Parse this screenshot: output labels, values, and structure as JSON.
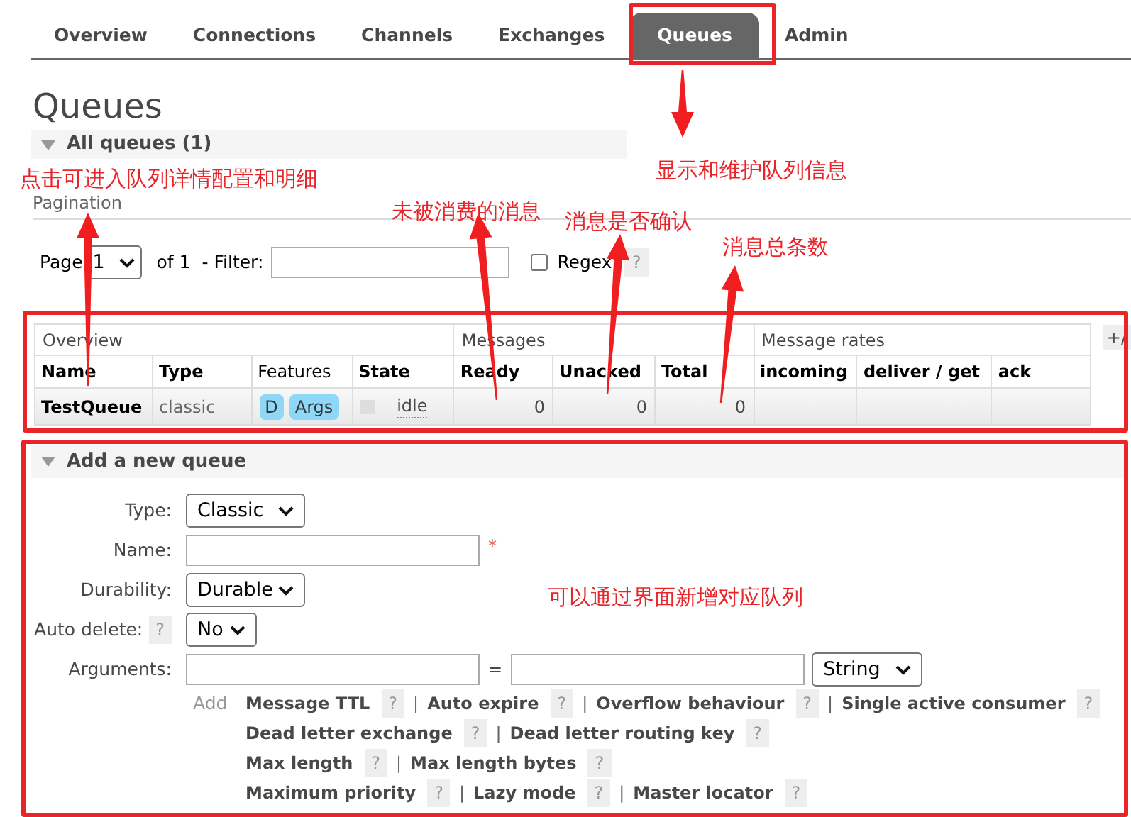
{
  "nav": {
    "tabs": [
      {
        "label": "Overview",
        "selected": false
      },
      {
        "label": "Connections",
        "selected": false
      },
      {
        "label": "Channels",
        "selected": false
      },
      {
        "label": "Exchanges",
        "selected": false
      },
      {
        "label": "Queues",
        "selected": true
      },
      {
        "label": "Admin",
        "selected": false
      }
    ]
  },
  "heading": "Queues",
  "all_queues": {
    "title": "All queues (1)",
    "pagination": {
      "title": "Pagination",
      "page_label": "Page",
      "page_value": "1",
      "of_label": "of 1",
      "filter_label": "- Filter:",
      "regex_label": "Regex",
      "regex_checked": false,
      "help": "?"
    }
  },
  "table": {
    "groups": [
      "Overview",
      "Messages",
      "Message rates"
    ],
    "toggle": "+/",
    "columns": [
      "Name",
      "Type",
      "Features",
      "State",
      "Ready",
      "Unacked",
      "Total",
      "incoming",
      "deliver / get",
      "ack"
    ],
    "rows": [
      {
        "name": "TestQueue",
        "type": "classic",
        "features": [
          "D",
          "Args"
        ],
        "state": "idle",
        "ready": "0",
        "unacked": "0",
        "total": "0"
      }
    ]
  },
  "add_queue": {
    "title": "Add a new queue",
    "fields": [
      {
        "label": "Type:",
        "kind": "select",
        "value": "Classic"
      },
      {
        "label": "Name:",
        "kind": "input",
        "required": "*"
      },
      {
        "label": "Durability:",
        "kind": "select",
        "value": "Durable"
      },
      {
        "label": "Auto delete:",
        "kind": "select",
        "value": "No",
        "help": "?"
      },
      {
        "label": "Arguments:",
        "kind": "arguments",
        "equals": "=",
        "value": "String"
      }
    ],
    "add_label": "Add",
    "separator": "|",
    "argument_rows": [
      [
        {
          "label": "Message TTL",
          "help": "?"
        },
        {
          "label": "Auto expire",
          "help": "?"
        },
        {
          "label": "Overflow behaviour",
          "help": "?"
        },
        {
          "label": "Single active consumer",
          "help": "?"
        }
      ],
      [
        {
          "label": "Dead letter exchange",
          "help": "?"
        },
        {
          "label": "Dead letter routing key",
          "help": "?"
        }
      ],
      [
        {
          "label": "Max length",
          "help": "?"
        },
        {
          "label": "Max length bytes",
          "help": "?"
        }
      ],
      [
        {
          "label": "Maximum priority",
          "help": "?"
        },
        {
          "label": "Lazy mode",
          "help": "?"
        },
        {
          "label": "Master locator",
          "help": "?"
        }
      ]
    ]
  },
  "annotations": [
    "显示和维护队列信息",
    "点击可进入队列详情配置和明细",
    "未被消费的消息",
    "消息是否确认",
    "消息总条数",
    "可以通过界面新增对应队列"
  ]
}
